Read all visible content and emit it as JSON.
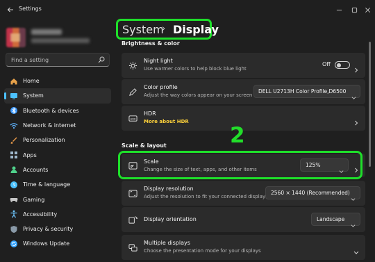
{
  "window": {
    "title": "Settings",
    "controls": [
      "minimize-icon",
      "maximize-icon",
      "close-icon"
    ]
  },
  "sidebar": {
    "search_placeholder": "Find a setting",
    "items": [
      {
        "label": "Home",
        "icon": "home-icon",
        "color": "#e8a24a"
      },
      {
        "label": "System",
        "icon": "system-icon",
        "color": "#4cc2ff",
        "active": true
      },
      {
        "label": "Bluetooth & devices",
        "icon": "bluetooth-icon",
        "color": "#3f9bff"
      },
      {
        "label": "Network & internet",
        "icon": "wifi-icon",
        "color": "#5fb4ff"
      },
      {
        "label": "Personalization",
        "icon": "brush-icon",
        "color": "#e89a4a"
      },
      {
        "label": "Apps",
        "icon": "apps-icon",
        "color": "#9fb8cc"
      },
      {
        "label": "Accounts",
        "icon": "accounts-icon",
        "color": "#4fd18b"
      },
      {
        "label": "Time & language",
        "icon": "globe-clock-icon",
        "color": "#4cc2ff"
      },
      {
        "label": "Gaming",
        "icon": "gamepad-icon",
        "color": "#c8c8c8"
      },
      {
        "label": "Accessibility",
        "icon": "accessibility-icon",
        "color": "#6ec6ff"
      },
      {
        "label": "Privacy & security",
        "icon": "shield-icon",
        "color": "#8a9aa8"
      },
      {
        "label": "Windows Update",
        "icon": "update-icon",
        "color": "#3fa9ff"
      }
    ]
  },
  "breadcrumb": {
    "parent": "System",
    "separator": "›",
    "current": "Display"
  },
  "sections": {
    "brightness": "Brightness & color",
    "scale_layout": "Scale & layout"
  },
  "cards": {
    "night_light": {
      "title": "Night light",
      "subtitle": "Use warmer colors to help block blue light",
      "state": "Off"
    },
    "color_profile": {
      "title": "Color profile",
      "subtitle": "Adjust the way colors appear on your screen",
      "value": "DELL U2713H Color Profile,D6500"
    },
    "hdr": {
      "title": "HDR",
      "subtitle": "More about HDR"
    },
    "scale": {
      "title": "Scale",
      "subtitle": "Change the size of text, apps, and other items",
      "value": "125%"
    },
    "resolution": {
      "title": "Display resolution",
      "subtitle": "Adjust the resolution to fit your connected display",
      "value": "2560 × 1440 (Recommended)"
    },
    "orientation": {
      "title": "Display orientation",
      "value": "Landscape"
    },
    "multiple": {
      "title": "Multiple displays",
      "subtitle": "Choose the presentation mode for your displays"
    }
  },
  "annotation": {
    "step_number": "2",
    "highlight_color": "#1ee02a"
  },
  "colors": {
    "accent": "#4cc2ff",
    "link": "#ffd23a",
    "background": "#1f1f1f",
    "card": "#2b2b2b"
  }
}
